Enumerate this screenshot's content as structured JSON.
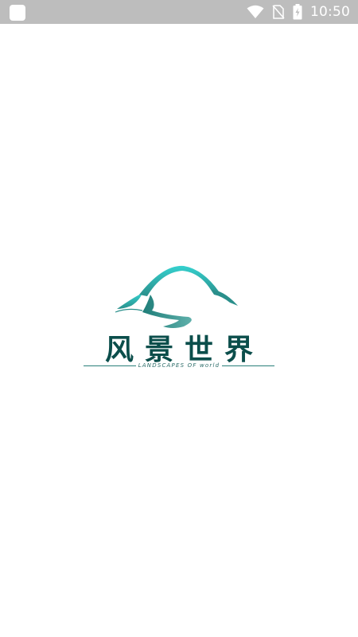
{
  "status_bar": {
    "time": "10:50",
    "icons": [
      "app-notification-icon",
      "wifi-icon",
      "no-sim-icon",
      "battery-charging-icon"
    ],
    "background": "#bdbdbd"
  },
  "splash": {
    "brand_name": "风景世界",
    "tagline": "LANDSCAPES OF world",
    "logo_icon": "mountain-road-icon",
    "colors": {
      "brand_text": "#0b4e4b",
      "mountain_light": "#2fc7c4",
      "mountain_dark": "#3a8f89"
    }
  }
}
